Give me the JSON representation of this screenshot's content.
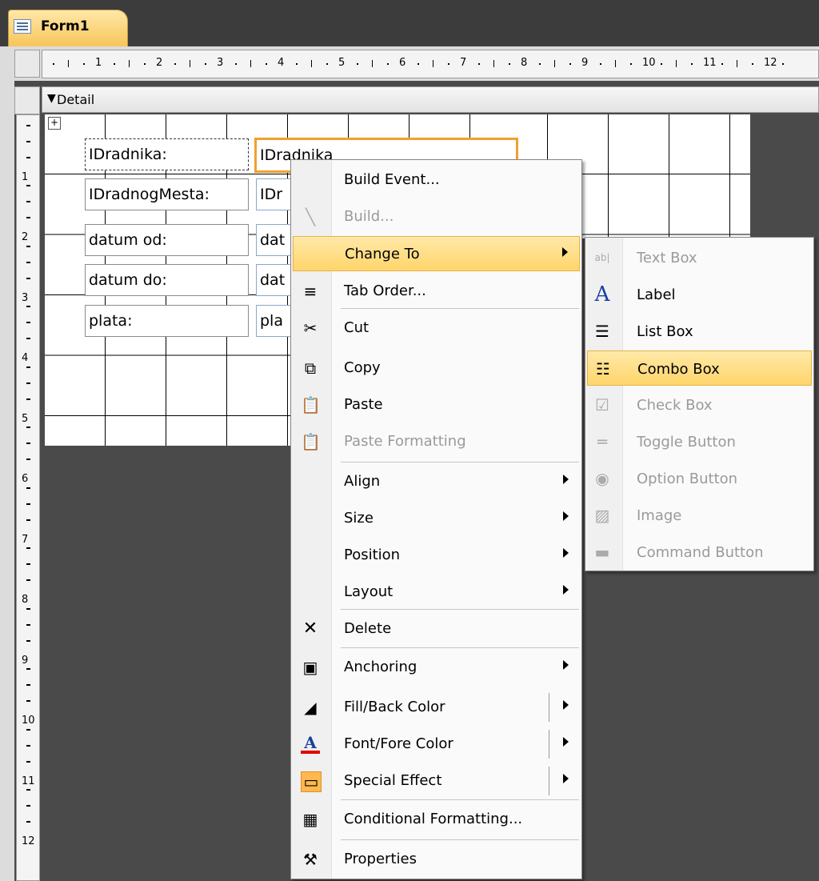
{
  "tab": {
    "title": "Form1"
  },
  "section": {
    "label": "Detail"
  },
  "ruler": {
    "horizontal": [
      "1",
      "2",
      "3",
      "4",
      "5",
      "6",
      "7",
      "8",
      "9",
      "10",
      "11",
      "12"
    ],
    "vertical": [
      "1",
      "2",
      "3",
      "4",
      "5",
      "6",
      "7",
      "8",
      "9",
      "10",
      "11",
      "12"
    ]
  },
  "form": {
    "labels": [
      "IDradnika:",
      "IDradnogMesta:",
      "datum od:",
      "datum do:",
      "plata:"
    ],
    "textboxes": [
      "IDradnika",
      "IDr",
      "dat",
      "dat",
      "pla"
    ]
  },
  "context_menu": {
    "items": [
      {
        "label": "Build Event...",
        "icon": "build-event-icon",
        "enabled": true
      },
      {
        "label": "Build...",
        "icon": "build-wand-icon",
        "enabled": false
      },
      {
        "label": "Change To",
        "icon": "",
        "enabled": true,
        "submenu": true,
        "highlighted": true
      },
      {
        "label": "Tab Order...",
        "icon": "tab-order-icon",
        "enabled": true
      },
      {
        "label": "Cut",
        "icon": "scissors-icon",
        "enabled": true
      },
      {
        "label": "Copy",
        "icon": "copy-icon",
        "enabled": true
      },
      {
        "label": "Paste",
        "icon": "paste-icon",
        "enabled": true
      },
      {
        "label": "Paste Formatting",
        "icon": "paste-formatting-icon",
        "enabled": false
      },
      {
        "label": "Align",
        "enabled": true,
        "submenu": true
      },
      {
        "label": "Size",
        "enabled": true,
        "submenu": true
      },
      {
        "label": "Position",
        "enabled": true,
        "submenu": true
      },
      {
        "label": "Layout",
        "enabled": true,
        "submenu": true
      },
      {
        "label": "Delete",
        "icon": "delete-x-icon",
        "enabled": true
      },
      {
        "label": "Anchoring",
        "icon": "anchoring-icon",
        "enabled": true,
        "submenu": true
      },
      {
        "label": "Fill/Back Color",
        "icon": "fill-color-icon",
        "enabled": true,
        "submenu": true
      },
      {
        "label": "Font/Fore Color",
        "icon": "font-color-icon",
        "enabled": true,
        "submenu": true
      },
      {
        "label": "Special Effect",
        "icon": "special-effect-icon",
        "enabled": true,
        "submenu": true
      },
      {
        "label": "Conditional Formatting...",
        "icon": "conditional-formatting-icon",
        "enabled": true
      },
      {
        "label": "Properties",
        "icon": "properties-icon",
        "enabled": true
      }
    ]
  },
  "change_to_submenu": {
    "items": [
      {
        "label": "Text Box",
        "icon": "text-box-icon",
        "enabled": false
      },
      {
        "label": "Label",
        "icon": "label-icon",
        "enabled": true
      },
      {
        "label": "List Box",
        "icon": "list-box-icon",
        "enabled": true
      },
      {
        "label": "Combo Box",
        "icon": "combo-box-icon",
        "enabled": true,
        "highlighted": true
      },
      {
        "label": "Check Box",
        "icon": "check-box-icon",
        "enabled": false
      },
      {
        "label": "Toggle Button",
        "icon": "toggle-button-icon",
        "enabled": false
      },
      {
        "label": "Option Button",
        "icon": "option-button-icon",
        "enabled": false
      },
      {
        "label": "Image",
        "icon": "image-icon",
        "enabled": false
      },
      {
        "label": "Command Button",
        "icon": "command-button-icon",
        "enabled": false
      }
    ]
  },
  "colors": {
    "accent": "#ffd56b",
    "selection_border": "#f0a030",
    "workspace": "#4a4a4a"
  }
}
